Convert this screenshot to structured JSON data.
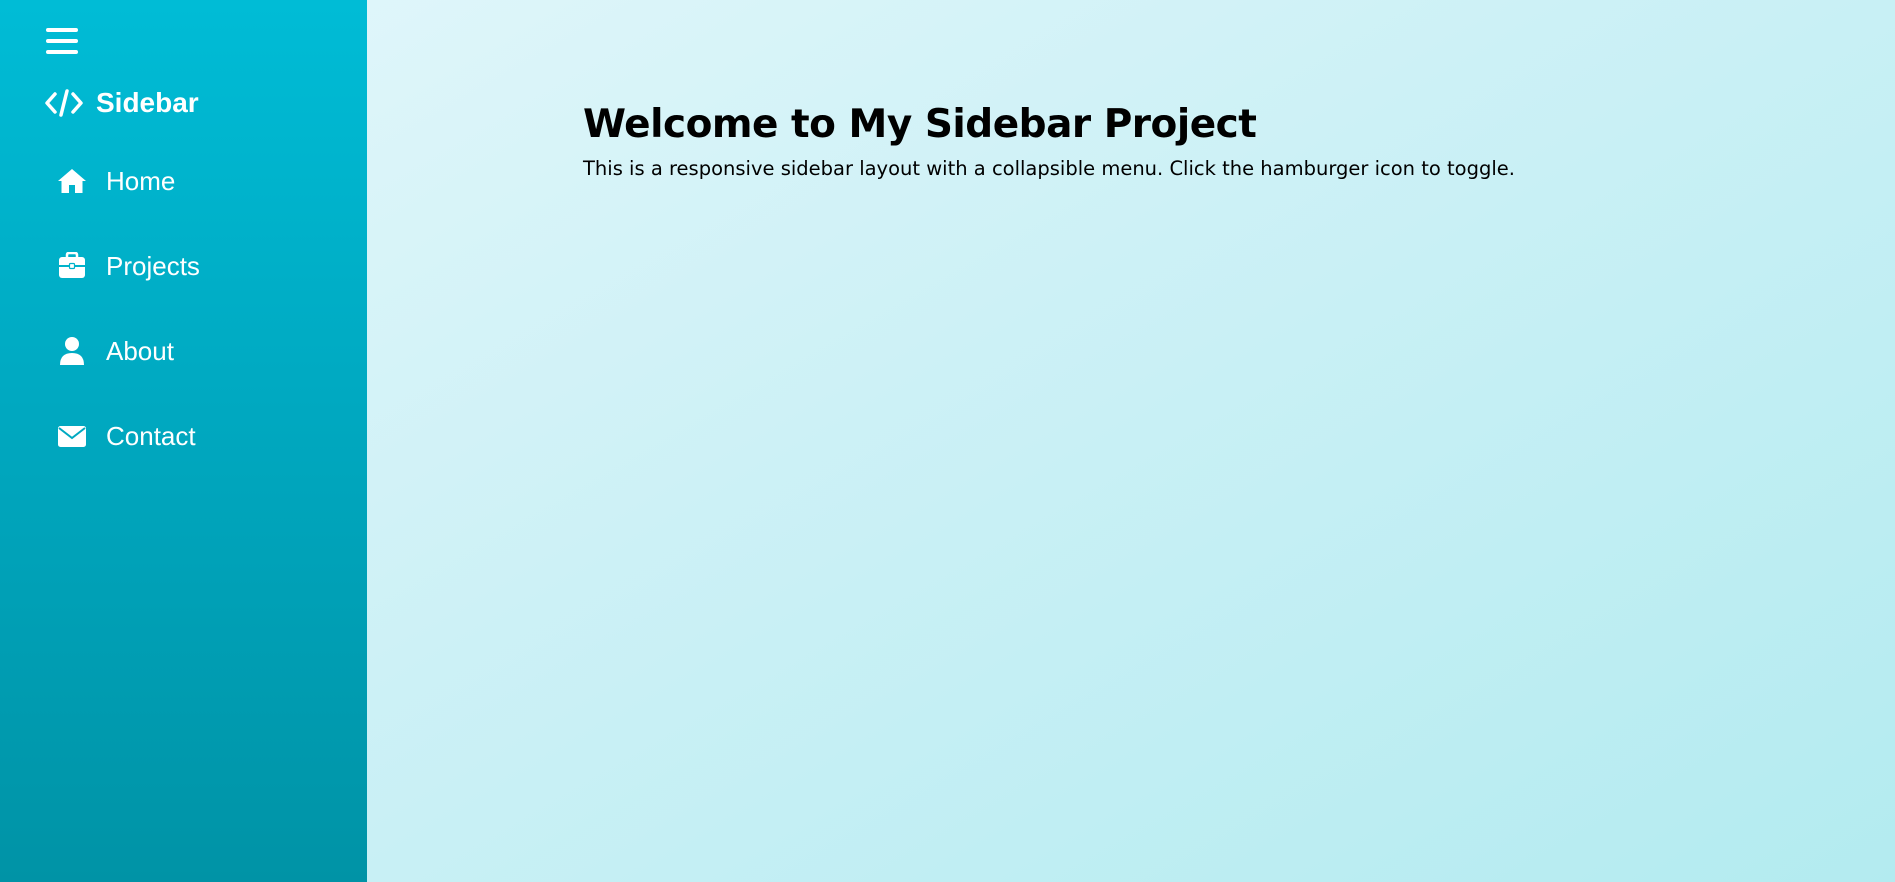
{
  "sidebar": {
    "brand": {
      "icon": "code-icon",
      "title": "Sidebar"
    },
    "toggle_icon": "hamburger-icon",
    "items": [
      {
        "label": "Home",
        "icon": "home-icon"
      },
      {
        "label": "Projects",
        "icon": "briefcase-icon"
      },
      {
        "label": "About",
        "icon": "user-icon"
      },
      {
        "label": "Contact",
        "icon": "envelope-icon"
      }
    ]
  },
  "main": {
    "heading": "Welcome to My Sidebar Project",
    "description": "This is a responsive sidebar layout with a collapsible menu. Click the hamburger icon to toggle."
  },
  "colors": {
    "sidebar_top": "#00bcd6",
    "sidebar_bottom": "#0093a6",
    "page_bg_light": "#e4f7fb",
    "page_bg_dark": "#b3ebf0",
    "sidebar_text": "#ffffff"
  }
}
